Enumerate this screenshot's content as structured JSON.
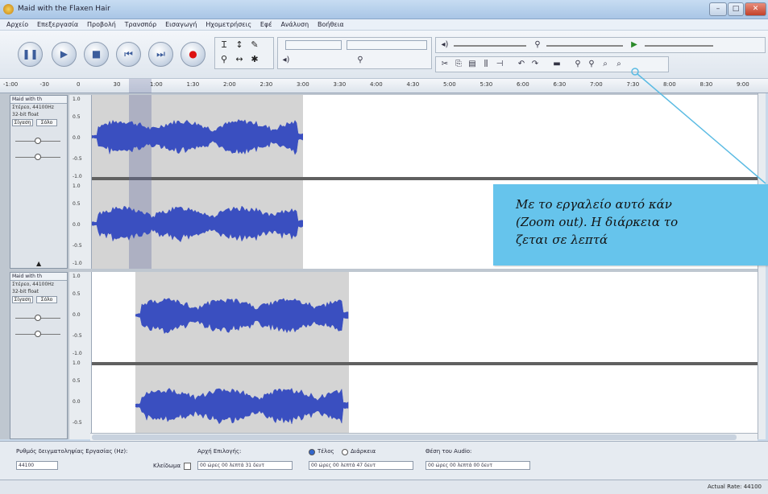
{
  "window": {
    "title": "Maid with the Flaxen Hair",
    "controls": [
      "–",
      "□",
      "✕"
    ]
  },
  "menu": [
    "Αρχείο",
    "Επεξεργασία",
    "Προβολή",
    "Τρανσπόρ",
    "Εισαγωγή",
    "Ηχομετρήσεις",
    "Εφέ",
    "Ανάλυση",
    "Βοήθεια"
  ],
  "transport": [
    {
      "name": "pause",
      "glyph": "❚❚"
    },
    {
      "name": "play",
      "glyph": "▶"
    },
    {
      "name": "stop",
      "glyph": "■"
    },
    {
      "name": "skip-start",
      "glyph": "⏮"
    },
    {
      "name": "skip-end",
      "glyph": "⏭"
    },
    {
      "name": "record",
      "glyph": "●"
    }
  ],
  "ruler": {
    "ticks": [
      "-1:00",
      "-30",
      "0",
      "30",
      "1:00",
      "1:30",
      "2:00",
      "2:30",
      "3:00",
      "3:30",
      "4:00",
      "4:30",
      "5:00",
      "5:30",
      "6:00",
      "6:30",
      "7:00",
      "7:30",
      "8:00",
      "8:30",
      "9:00"
    ]
  },
  "tracks": [
    {
      "name": "Maid with th",
      "info": [
        "Στέρεο, 44100Hz",
        "32-bit float"
      ],
      "mute": "Σίγαση",
      "solo": "Σόλο",
      "scale": [
        "1.0",
        "0.5",
        "0.0",
        "-0.5",
        "-1.0"
      ]
    },
    {
      "name": "Maid with th",
      "info": [
        "Στέρεο, 44100Hz",
        "32-bit float"
      ],
      "mute": "Σίγαση",
      "solo": "Σόλο",
      "scale": [
        "1.0",
        "0.5",
        "0.0",
        "-0.5",
        "-1.0"
      ]
    }
  ],
  "selection_bar": {
    "rate_label": "Ρυθμός δειγματοληψίας Εργασίας (Hz):",
    "rate_value": "44100",
    "snap_label": "Κλείδωμα",
    "start_label": "Αρχή Επιλογής:",
    "end_label": "Τέλος",
    "length_label": "Διάρκεια",
    "audio_pos_label": "Θέση του Audio:",
    "start_value": "00 ώρες 00 λεπτά 31 δευτ",
    "end_value": "00 ώρες 00 λεπτά 47 δευτ",
    "audio_value": "00 ώρες 00 λεπτά 00 δευτ"
  },
  "status": {
    "right": "Actual Rate: 44100"
  },
  "callout": {
    "lines": [
      "Με το εργαλείο αυτό κάν",
      "(Zoom out). Η διάρκεια το",
      "ζεται σε λεπτά"
    ],
    "color": "#66c4ec"
  }
}
